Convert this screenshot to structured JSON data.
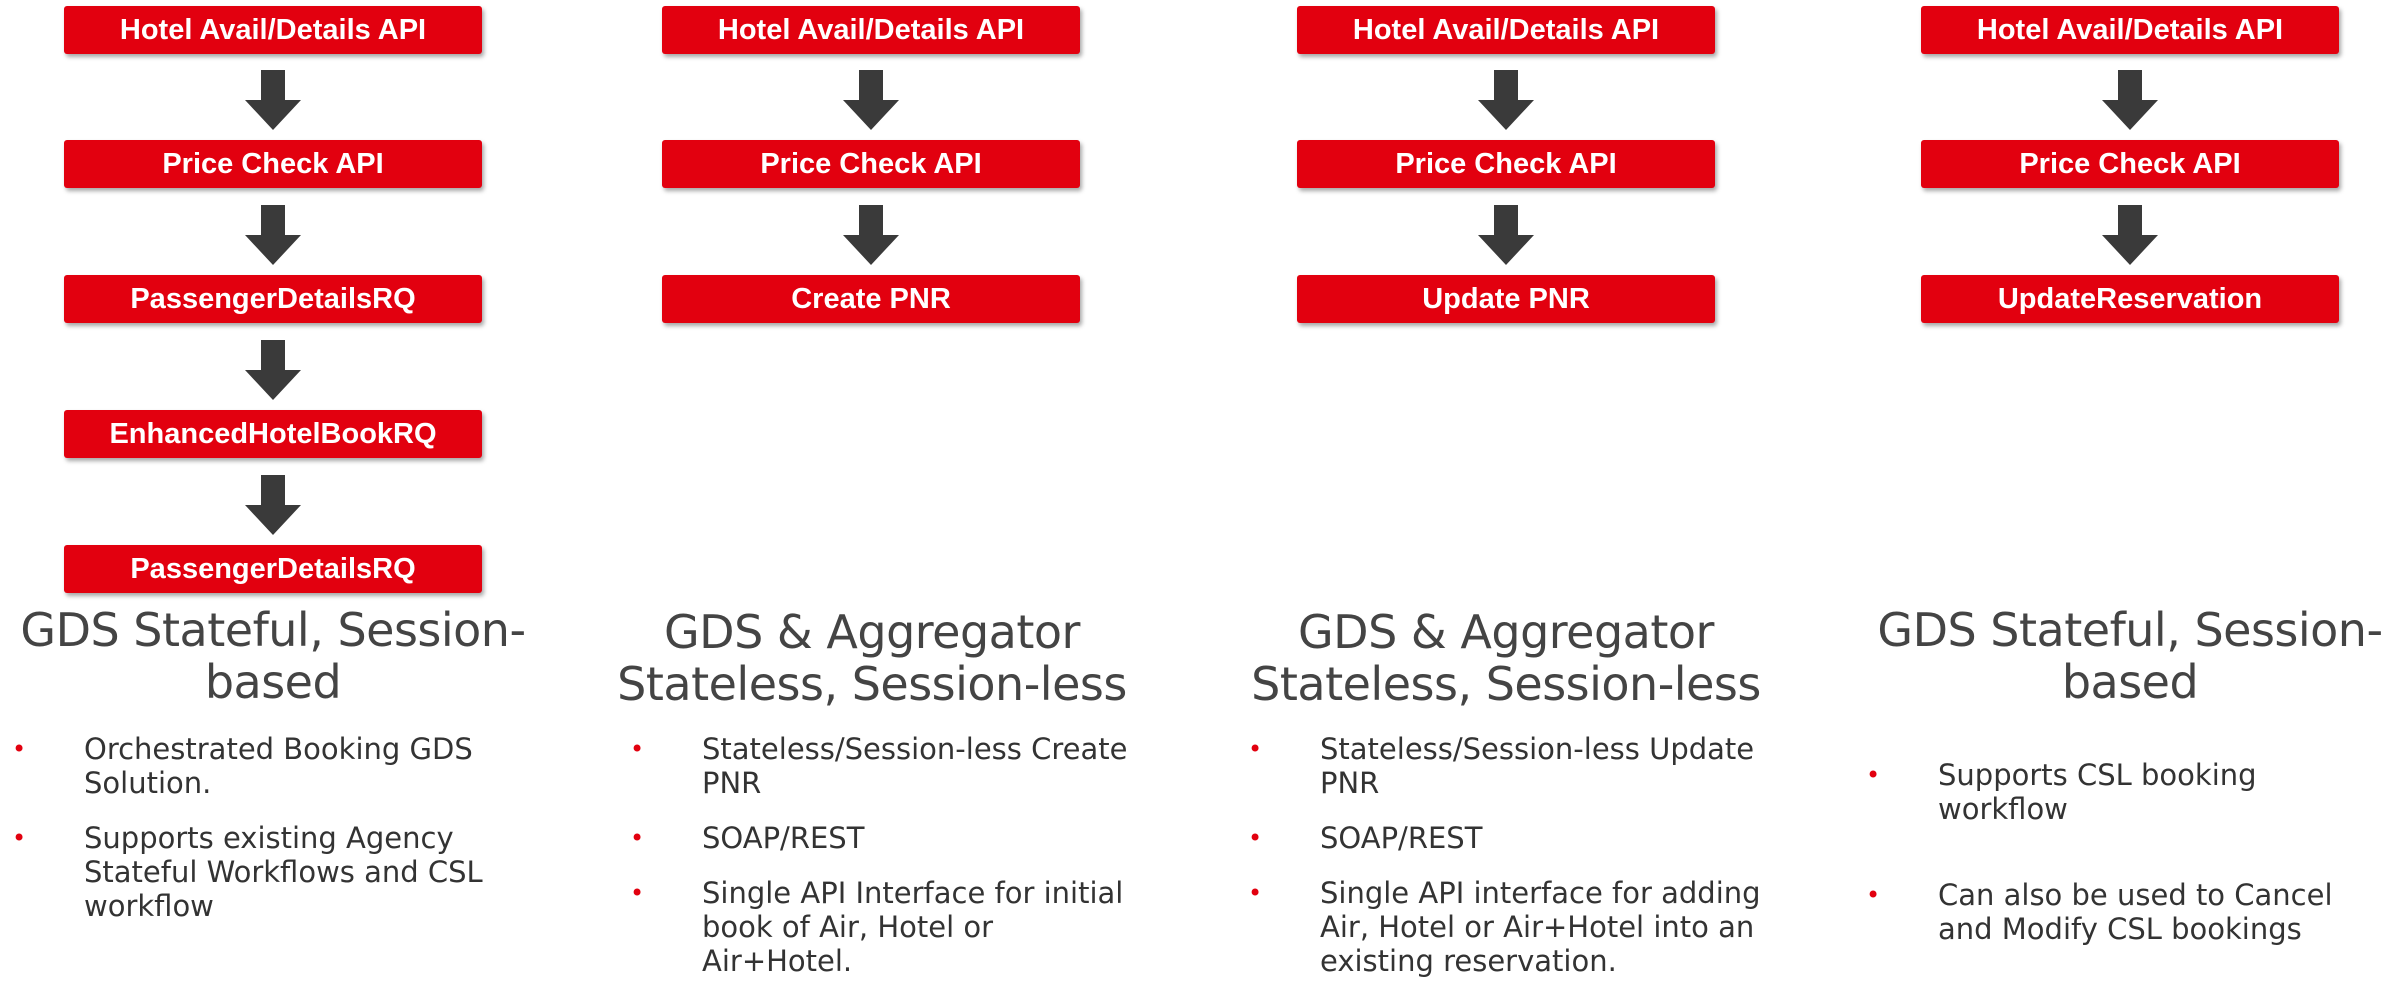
{
  "accent_color": "#e2000f",
  "arrow_color": "#3a3a3a",
  "columns": [
    {
      "steps": [
        "Hotel Avail/Details API",
        "Price Check API",
        "PassengerDetailsRQ",
        "EnhancedHotelBookRQ",
        "PassengerDetailsRQ"
      ],
      "heading": [
        "GDS Stateful, Session-",
        "based"
      ],
      "bullets": [
        [
          "Orchestrated Booking GDS",
          "Solution."
        ],
        [
          "Supports existing Agency",
          "Stateful Workflows and CSL",
          "workflow"
        ]
      ]
    },
    {
      "steps": [
        "Hotel Avail/Details API",
        "Price Check API",
        "Create PNR"
      ],
      "heading": [
        "GDS & Aggregator",
        "Stateless, Session-less"
      ],
      "bullets": [
        [
          "Stateless/Session-less Create",
          "PNR"
        ],
        [
          "SOAP/REST"
        ],
        [
          "Single API Interface for initial",
          "book of Air, Hotel or Air+Hotel."
        ]
      ]
    },
    {
      "steps": [
        "Hotel Avail/Details API",
        "Price Check API",
        "Update PNR"
      ],
      "heading": [
        "GDS & Aggregator",
        "Stateless, Session-less"
      ],
      "bullets": [
        [
          "Stateless/Session-less Update",
          "PNR"
        ],
        [
          "SOAP/REST"
        ],
        [
          "Single API interface for adding",
          "Air, Hotel or Air+Hotel into an",
          "existing reservation."
        ]
      ]
    },
    {
      "steps": [
        "Hotel Avail/Details API",
        "Price Check API",
        "UpdateReservation"
      ],
      "heading": [
        "GDS Stateful, Session-",
        "based"
      ],
      "bullets": [
        [
          "Supports CSL booking",
          "workflow"
        ],
        [
          "Can also be used to Cancel",
          "and Modify CSL bookings"
        ]
      ]
    }
  ]
}
